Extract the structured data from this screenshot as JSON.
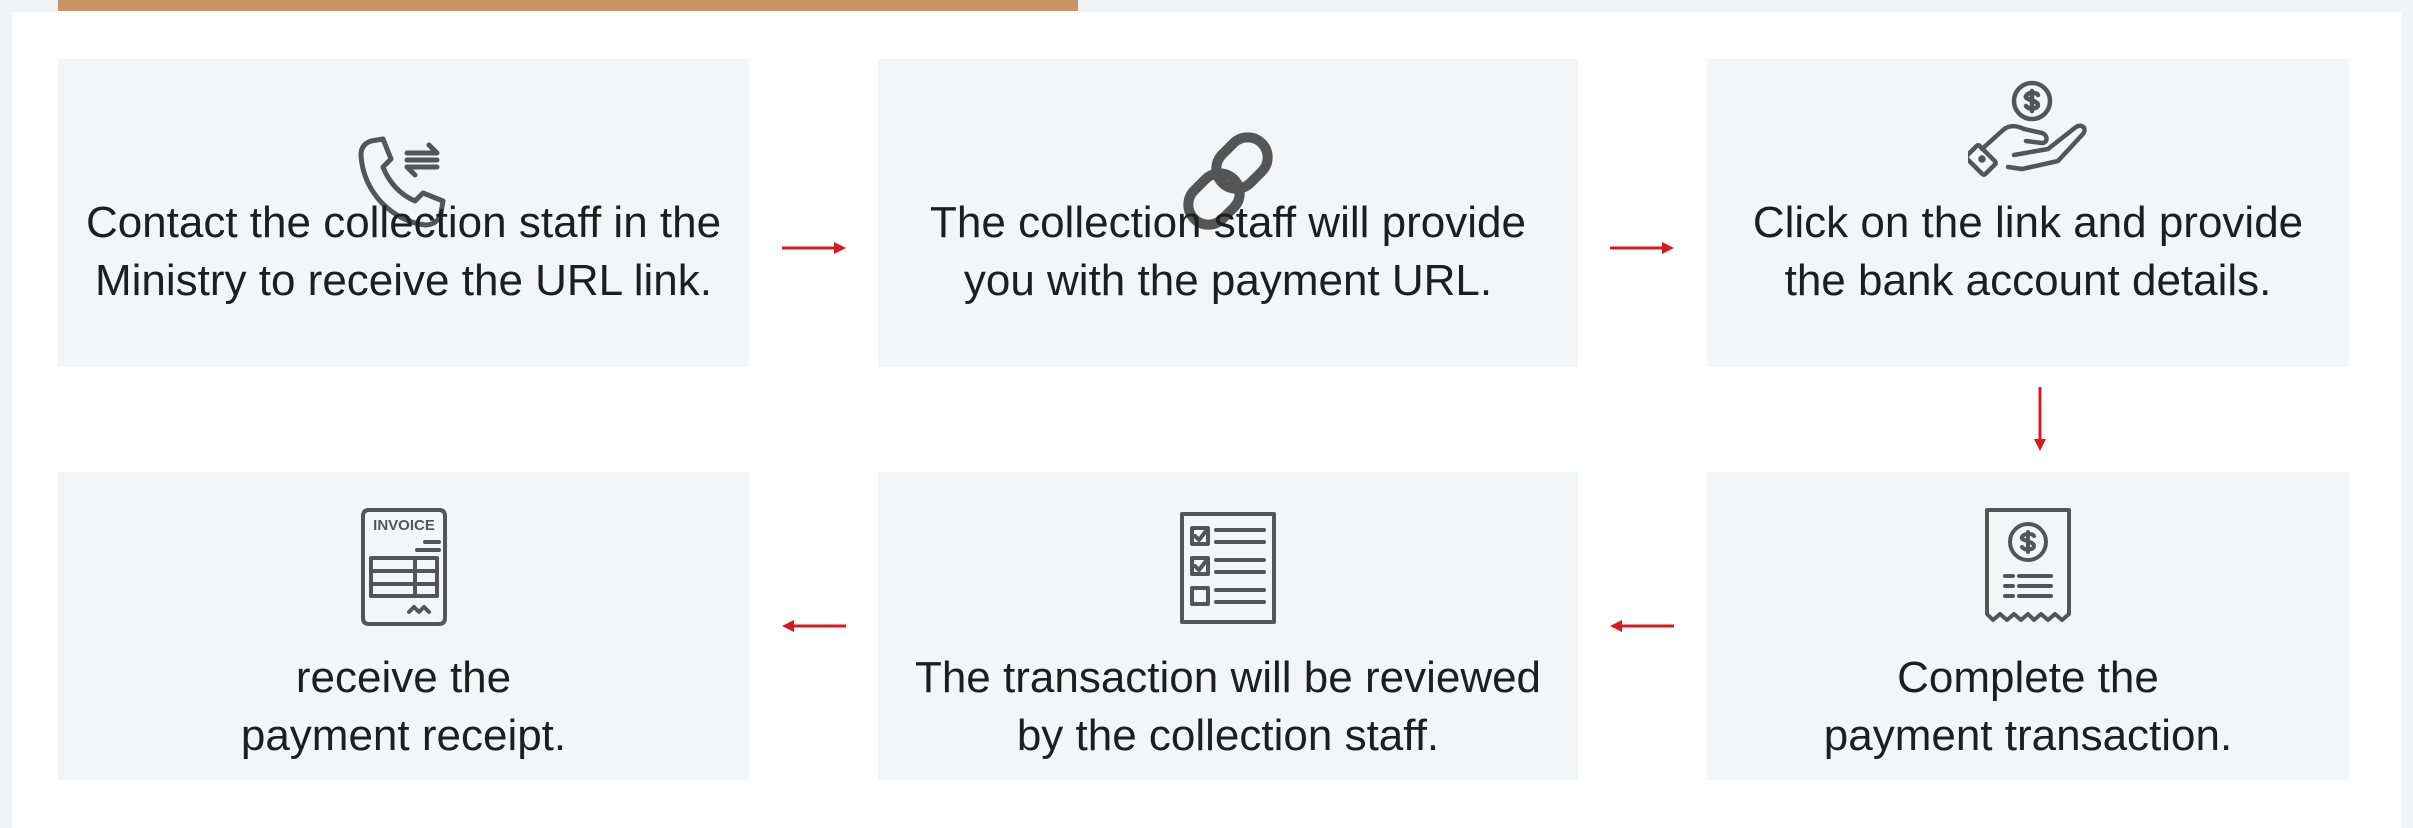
{
  "accent_colors": {
    "top_bar": "#c89466",
    "arrow": "#d71920",
    "icon_stroke": "#555555",
    "box_fill": "#f4f5f7",
    "text": "#1e1e1e"
  },
  "steps": [
    {
      "icon": "phone-transfer-icon",
      "line1": "Contact the collection staff in the",
      "line2": "Ministry to receive the URL link."
    },
    {
      "icon": "link-icon",
      "line1": "The collection staff will provide",
      "line2": "you with the payment URL."
    },
    {
      "icon": "hand-coin-icon",
      "line1": "Click on the link  and provide",
      "line2": "the bank account details."
    },
    {
      "icon": "receipt-dollar-icon",
      "line1": "Complete the",
      "line2": "payment transaction."
    },
    {
      "icon": "checklist-icon",
      "line1": "The transaction will be reviewed",
      "line2": "by the collection staff."
    },
    {
      "icon": "invoice-icon",
      "icon_label": "INVOICE",
      "line1": "receive the",
      "line2": "payment receipt."
    }
  ]
}
